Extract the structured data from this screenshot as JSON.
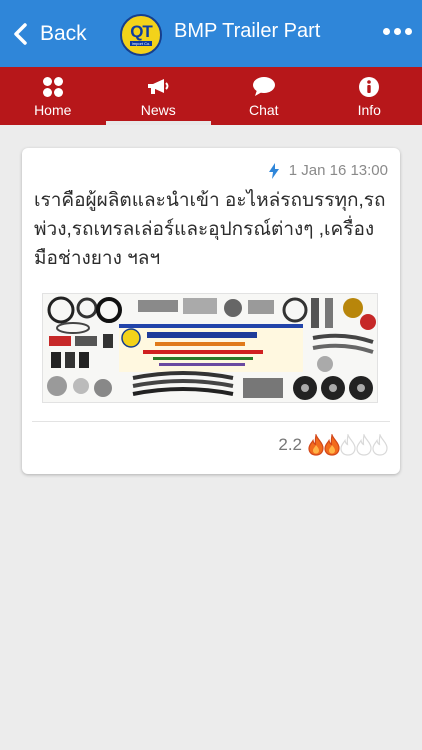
{
  "header": {
    "back_label": "Back",
    "logo_text": "QT",
    "logo_subtext": "Import Co.",
    "title": "BMP Trailer Part"
  },
  "tabs": [
    {
      "label": "Home",
      "icon": "grid-icon"
    },
    {
      "label": "News",
      "icon": "megaphone-icon",
      "active": true
    },
    {
      "label": "Chat",
      "icon": "chat-bubble-icon"
    },
    {
      "label": "Info",
      "icon": "info-icon"
    }
  ],
  "post": {
    "date": "1 Jan 16 13:00",
    "text": "เราคือผู้ผลิตและนำเข้า อะไหล่รถบรรทุก,รถพ่วง,รถเทรลเล่อร์และอุปกรณ์ต่างๆ ,เครื่องมือช่างยาง ฯลฯ",
    "image_alt": "trailer-parts-catalog-image",
    "rating_value": "2.2",
    "rating_filled": 2,
    "rating_total": 5
  },
  "colors": {
    "header_bg": "#2f86d9",
    "tabbar_bg": "#b7171a",
    "flame_active": "#f26b1d",
    "flame_inactive": "#d9d9d9"
  }
}
